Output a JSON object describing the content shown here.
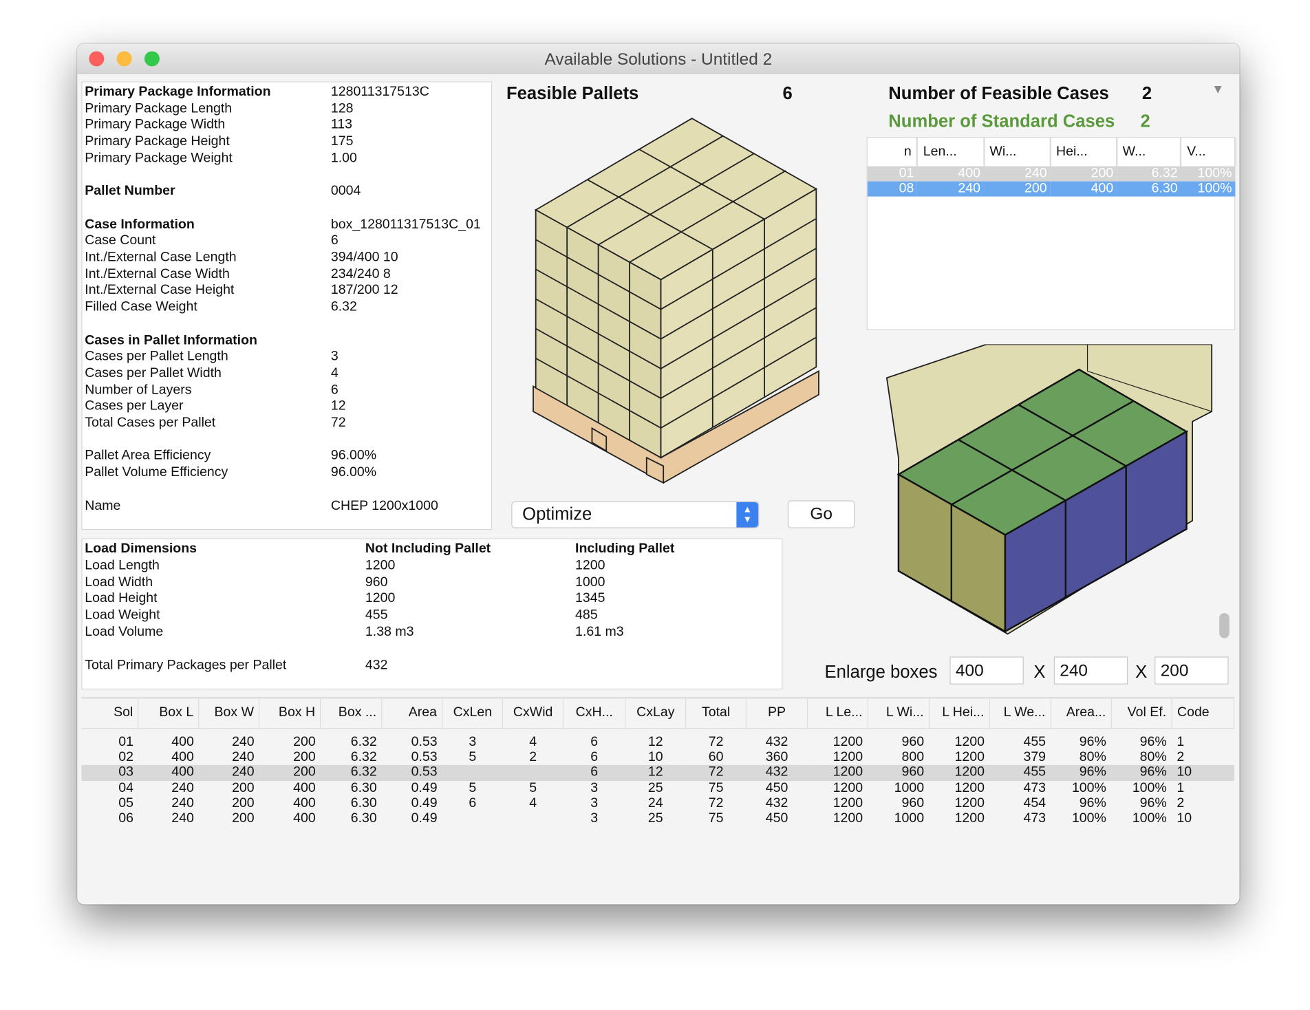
{
  "window": {
    "title": "Available Solutions - Untitled 2"
  },
  "info": {
    "rows": [
      {
        "label": "Primary Package Information",
        "value": "128011317513C",
        "bold": true
      },
      {
        "label": "Primary Package Length",
        "value": "128"
      },
      {
        "label": "Primary Package Width",
        "value": "113"
      },
      {
        "label": "Primary Package Height",
        "value": "175"
      },
      {
        "label": "Primary Package Weight",
        "value": "1.00"
      },
      {
        "label": "Pallet Number",
        "value": "0004",
        "bold": true,
        "gap": true
      },
      {
        "label": "Case Information",
        "value": "box_128011317513C_01",
        "bold": true,
        "gap": true
      },
      {
        "label": "Case Count",
        "value": "6"
      },
      {
        "label": "Int./External Case Length",
        "value": "394/400   10"
      },
      {
        "label": "Int./External Case Width",
        "value": "234/240   8"
      },
      {
        "label": "Int./External Case Height",
        "value": "187/200   12"
      },
      {
        "label": "Filled Case Weight",
        "value": "6.32"
      },
      {
        "label": "Cases in Pallet Information",
        "value": "",
        "bold": true,
        "gap": true
      },
      {
        "label": "Cases per Pallet Length",
        "value": "3"
      },
      {
        "label": "Cases per Pallet Width",
        "value": "4"
      },
      {
        "label": "Number of Layers",
        "value": "6"
      },
      {
        "label": "Cases per Layer",
        "value": "12"
      },
      {
        "label": "Total Cases per Pallet",
        "value": "72"
      },
      {
        "label": "Pallet Area Efficiency",
        "value": "96.00%",
        "gap": true
      },
      {
        "label": "Pallet Volume Efficiency",
        "value": "96.00%"
      },
      {
        "label": "Name",
        "value": "CHEP 1200x1000",
        "gap": true
      }
    ]
  },
  "load": {
    "headers": [
      "Load Dimensions",
      "Not Including Pallet",
      "Including Pallet"
    ],
    "rows": [
      [
        "Load Length",
        "1200",
        "1200"
      ],
      [
        "Load Width",
        "960",
        "1000"
      ],
      [
        "Load Height",
        "1200",
        "1345"
      ],
      [
        "Load Weight",
        "455",
        "485"
      ],
      [
        "Load Volume",
        "1.38 m3",
        "1.61 m3"
      ]
    ],
    "total_label": "Total Primary Packages per Pallet",
    "total_value": "432"
  },
  "feasible": {
    "label": "Feasible Pallets",
    "count": "6"
  },
  "optimize": {
    "selected": "Optimize",
    "go": "Go"
  },
  "cases": {
    "feasible_label": "Number of Feasible Cases",
    "feasible_count": "2",
    "standard_label": "Number of Standard Cases",
    "standard_count": "2",
    "standard_color": "#5b9a3c",
    "columns": [
      "n",
      "Len...",
      "Wi...",
      "Hei...",
      "W...",
      "V..."
    ],
    "rows": [
      [
        "01",
        "400",
        "240",
        "200",
        "6.32",
        "100%"
      ],
      [
        "08",
        "240",
        "200",
        "400",
        "6.30",
        "100%"
      ]
    ]
  },
  "enlarge": {
    "label": "Enlarge boxes",
    "x": "400",
    "y": "240",
    "z": "200",
    "sep": "X"
  },
  "solutions": {
    "columns": [
      "Sol",
      "Box L",
      "Box W",
      "Box H",
      "Box ...",
      "Area",
      "CxLen",
      "CxWid",
      "CxH...",
      "CxLay",
      "Total",
      "PP",
      "L Le...",
      "L Wi...",
      "L Hei...",
      "L We...",
      "Area...",
      "Vol Ef.",
      "Code"
    ],
    "rows": [
      [
        "01",
        "400",
        "240",
        "200",
        "6.32",
        "0.53",
        "3",
        "4",
        "6",
        "12",
        "72",
        "432",
        "1200",
        "960",
        "1200",
        "455",
        "96%",
        "96%",
        "1"
      ],
      [
        "02",
        "400",
        "240",
        "200",
        "6.32",
        "0.53",
        "5",
        "2",
        "6",
        "10",
        "60",
        "360",
        "1200",
        "800",
        "1200",
        "379",
        "80%",
        "80%",
        "2"
      ],
      [
        "03",
        "400",
        "240",
        "200",
        "6.32",
        "0.53",
        "",
        "",
        "6",
        "12",
        "72",
        "432",
        "1200",
        "960",
        "1200",
        "455",
        "96%",
        "96%",
        "10"
      ],
      [
        "04",
        "240",
        "200",
        "400",
        "6.30",
        "0.49",
        "5",
        "5",
        "3",
        "25",
        "75",
        "450",
        "1200",
        "1000",
        "1200",
        "473",
        "100%",
        "100%",
        "1"
      ],
      [
        "05",
        "240",
        "200",
        "400",
        "6.30",
        "0.49",
        "6",
        "4",
        "3",
        "24",
        "72",
        "432",
        "1200",
        "960",
        "1200",
        "454",
        "96%",
        "96%",
        "2"
      ],
      [
        "06",
        "240",
        "200",
        "400",
        "6.30",
        "0.49",
        "",
        "",
        "3",
        "25",
        "75",
        "450",
        "1200",
        "1000",
        "1200",
        "473",
        "100%",
        "100%",
        "10"
      ]
    ],
    "selected_row": "03"
  },
  "colors": {
    "selection_blue": "#6aa9f0",
    "case_top": "#6a9e5c",
    "case_left": "#9fa060",
    "case_right": "#4f529a",
    "pallet_case": "#e2ddb2",
    "pallet_wood": "#e9c9a0"
  }
}
